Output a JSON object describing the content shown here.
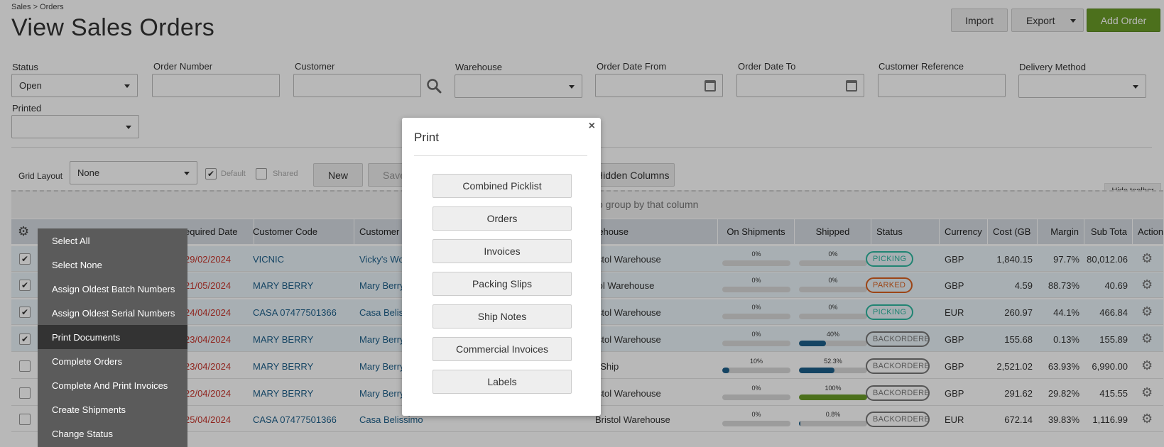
{
  "header": {
    "breadcrumb": "Sales > Orders",
    "title": "View Sales Orders",
    "import_label": "Import",
    "export_label": "Export",
    "add_order_label": "Add Order"
  },
  "filters": {
    "status_label": "Status",
    "status_value": "Open",
    "order_number_label": "Order Number",
    "customer_label": "Customer",
    "warehouse_label": "Warehouse",
    "order_date_from_label": "Order Date From",
    "order_date_to_label": "Order Date To",
    "customer_reference_label": "Customer Reference",
    "delivery_method_label": "Delivery Method",
    "printed_label": "Printed"
  },
  "grid_toolbar": {
    "grid_layout_label": "Grid Layout",
    "grid_layout_value": "None",
    "default_label": "Default",
    "shared_label": "Shared",
    "new_label": "New",
    "save_label": "Save",
    "hidden_columns_label": "Hidden Columns",
    "hide_toolbar_label": "Hide toolbar",
    "group_hint": "o group by that column"
  },
  "table": {
    "headers": {
      "required_date": "equired Date",
      "customer_code": "Customer Code",
      "customer_name": "Customer N",
      "warehouse": "rehouse",
      "on_shipments": "On Shipments",
      "shipped": "Shipped",
      "status": "Status",
      "currency": "Currency",
      "cost": "Cost (GB",
      "margin": "Margin",
      "sub_total": "Sub Tota",
      "action": "Action"
    },
    "rows": [
      {
        "checked": "✔",
        "date": "29/02/2024",
        "code": "VICNIC",
        "name": "Vicky's Won",
        "warehouse": "istol Warehouse",
        "on_ship": "0%",
        "on_ship_pct": 0,
        "shipped": "0%",
        "shipped_pct": 0,
        "status": "PICKING",
        "status_color": "#2eb8a0",
        "currency": "GBP",
        "cost": "1,840.15",
        "margin": "97.7%",
        "subtotal": "80,012.06"
      },
      {
        "checked": "✔",
        "date": "21/05/2024",
        "code": "MARY BERRY",
        "name": "Mary Berry L",
        "warehouse": "tol Warehouse",
        "on_ship": "0%",
        "on_ship_pct": 0,
        "shipped": "0%",
        "shipped_pct": 0,
        "status": "PARKED",
        "status_color": "#d9601f",
        "currency": "GBP",
        "cost": "4.59",
        "margin": "88.73%",
        "subtotal": "40.69"
      },
      {
        "checked": "✔",
        "date": "24/04/2024",
        "code": "CASA 07477501366",
        "name": "Casa Belissi",
        "warehouse": "istol Warehouse",
        "on_ship": "0%",
        "on_ship_pct": 0,
        "shipped": "0%",
        "shipped_pct": 0,
        "status": "PICKING",
        "status_color": "#2eb8a0",
        "currency": "EUR",
        "cost": "260.97",
        "margin": "44.1%",
        "subtotal": "466.84"
      },
      {
        "checked": "✔",
        "date": "23/04/2024",
        "code": "MARY BERRY",
        "name": "Mary Berry L",
        "warehouse": "istol Warehouse",
        "on_ship": "0%",
        "on_ship_pct": 0,
        "shipped": "40%",
        "shipped_pct": 40,
        "status": "BACKORDERED",
        "status_color": "#777777",
        "currency": "GBP",
        "cost": "155.68",
        "margin": "0.13%",
        "subtotal": "155.89"
      },
      {
        "checked": "",
        "date": "23/04/2024",
        "code": "MARY BERRY",
        "name": "Mary Berry L",
        "warehouse": "pShip",
        "on_ship": "10%",
        "on_ship_pct": 10,
        "shipped": "52.3%",
        "shipped_pct": 52.3,
        "status": "BACKORDERED",
        "status_color": "#777777",
        "currency": "GBP",
        "cost": "2,521.02",
        "margin": "63.93%",
        "subtotal": "6,990.00"
      },
      {
        "checked": "",
        "date": "22/04/2024",
        "code": "MARY BERRY",
        "name": "Mary Berry L",
        "warehouse": "istol Warehouse",
        "on_ship": "0%",
        "on_ship_pct": 0,
        "shipped": "100%",
        "shipped_pct": 100,
        "status": "BACKORDERED",
        "status_color": "#777777",
        "currency": "GBP",
        "cost": "291.62",
        "margin": "29.82%",
        "subtotal": "415.55"
      },
      {
        "checked": "",
        "date": "25/04/2024",
        "code": "CASA 07477501366",
        "name": "Casa Belissimo",
        "warehouse": "Bristol Warehouse",
        "on_ship": "0%",
        "on_ship_pct": 0,
        "shipped": "0.8%",
        "shipped_pct": 0.8,
        "status": "BACKORDERED",
        "status_color": "#777777",
        "currency": "EUR",
        "cost": "672.14",
        "margin": "39.83%",
        "subtotal": "1,116.99"
      }
    ]
  },
  "context_menu": {
    "items": [
      "Select All",
      "Select None",
      "Assign Oldest Batch Numbers",
      "Assign Oldest Serial Numbers",
      "Print Documents",
      "Complete Orders",
      "Complete And Print Invoices",
      "Create Shipments",
      "Change Status"
    ],
    "active_index": 4
  },
  "print_modal": {
    "title": "Print",
    "close": "×",
    "buttons": [
      "Combined Picklist",
      "Orders",
      "Invoices",
      "Packing Slips",
      "Ship Notes",
      "Commercial Invoices",
      "Labels"
    ]
  },
  "colors": {
    "accent_green": "#6a9c27",
    "link_blue": "#1d5f8a",
    "date_red": "#c7342b",
    "progress_blue": "#1d5f8a",
    "progress_green": "#6a9c27"
  },
  "icons": {
    "search": "search-icon",
    "calendar": "calendar-icon",
    "gear": "gear-icon",
    "close": "close-icon"
  }
}
